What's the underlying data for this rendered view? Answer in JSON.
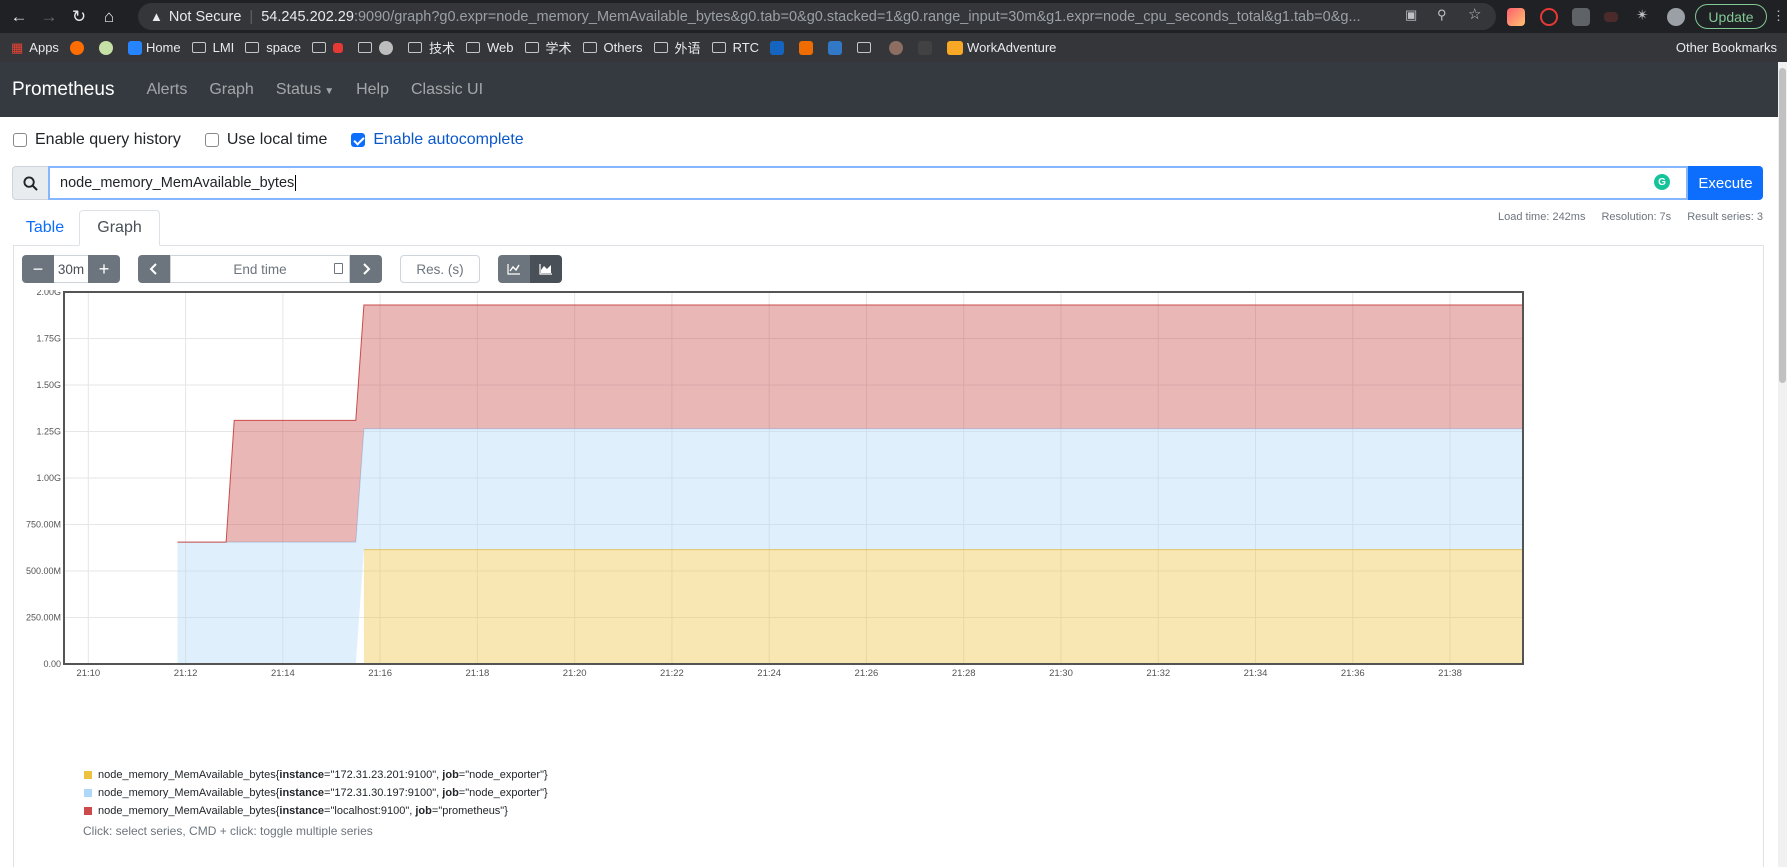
{
  "browser": {
    "security_label": "Not Secure",
    "url_host": "54.245.202.29",
    "url_path": ":9090/graph?g0.expr=node_memory_MemAvailable_bytes&g0.tab=0&g0.stacked=1&g0.range_input=30m&g1.expr=node_cpu_seconds_total&g1.tab=0&g...",
    "update_label": "Update",
    "bookmarks": [
      "Apps",
      "Home",
      "LMI",
      "space",
      "技术",
      "Web",
      "学术",
      "Others",
      "外语",
      "RTC",
      "WorkAdventure"
    ],
    "other_bookmarks": "Other Bookmarks"
  },
  "navbar": {
    "brand": "Prometheus",
    "links": [
      "Alerts",
      "Graph",
      "Status",
      "Help",
      "Classic UI"
    ]
  },
  "options": {
    "query_history": {
      "label": "Enable query history",
      "checked": false
    },
    "local_time": {
      "label": "Use local time",
      "checked": false
    },
    "autocomplete": {
      "label": "Enable autocomplete",
      "checked": true
    }
  },
  "query": {
    "expression": "node_memory_MemAvailable_bytes",
    "execute_label": "Execute"
  },
  "tabs": {
    "table": "Table",
    "graph": "Graph",
    "active": "Graph"
  },
  "stats": {
    "load_time": "Load time: 242ms",
    "resolution": "Resolution: 7s",
    "result_series": "Result series: 3"
  },
  "controls": {
    "range": "30m",
    "end_time_placeholder": "End time",
    "resolution_placeholder": "Res. (s)",
    "stacked": true
  },
  "chart_data": {
    "type": "area",
    "stacked": true,
    "ylim": [
      0,
      2.0
    ],
    "y_unit": "G",
    "y_ticks": [
      "0.00",
      "250.00M",
      "500.00M",
      "750.00M",
      "1.00G",
      "1.25G",
      "1.50G",
      "1.75G",
      "2.00G"
    ],
    "x_range": [
      "21:09:30",
      "21:39:30"
    ],
    "x_ticks": [
      "21:10",
      "21:12",
      "21:14",
      "21:16",
      "21:18",
      "21:20",
      "21:22",
      "21:24",
      "21:26",
      "21:28",
      "21:30",
      "21:32",
      "21:34",
      "21:36",
      "21:38"
    ],
    "grid": true,
    "series": [
      {
        "name": "node_memory_MemAvailable_bytes{instance=\"172.31.23.201:9100\", job=\"node_exporter\"}",
        "color": "#edc240",
        "x": [
          "21:15:40",
          "21:39:30"
        ],
        "values": [
          0.615,
          0.615
        ]
      },
      {
        "name": "node_memory_MemAvailable_bytes{instance=\"172.31.30.197:9100\", job=\"node_exporter\"}",
        "color": "#afd8f8",
        "x": [
          "21:11:50",
          "21:15:30",
          "21:15:40",
          "21:39:30"
        ],
        "values": [
          0.655,
          0.655,
          0.65,
          0.65
        ]
      },
      {
        "name": "node_memory_MemAvailable_bytes{instance=\"localhost:9100\", job=\"prometheus\"}",
        "color": "#cb4b4b",
        "x": [
          "21:11:50",
          "21:12:50",
          "21:13:00",
          "21:15:30",
          "21:15:40",
          "21:39:30"
        ],
        "values": [
          0.0,
          0.0,
          0.655,
          0.655,
          0.665,
          0.665
        ]
      }
    ]
  },
  "legend": {
    "prefix": "node_memory_MemAvailable_bytes{",
    "items": [
      {
        "instance": "\"172.31.23.201:9100\"",
        "job": "\"node_exporter\"",
        "color": "#edc240"
      },
      {
        "instance": "\"172.31.30.197:9100\"",
        "job": "\"node_exporter\"",
        "color": "#afd8f8"
      },
      {
        "instance": "\"localhost:9100\"",
        "job": "\"prometheus\"",
        "color": "#cb4b4b"
      }
    ],
    "instance_key": "instance",
    "job_key": "job",
    "eq": "=",
    "comma": ", ",
    "close": "}",
    "hint": "Click: select series, CMD + click: toggle multiple series"
  }
}
